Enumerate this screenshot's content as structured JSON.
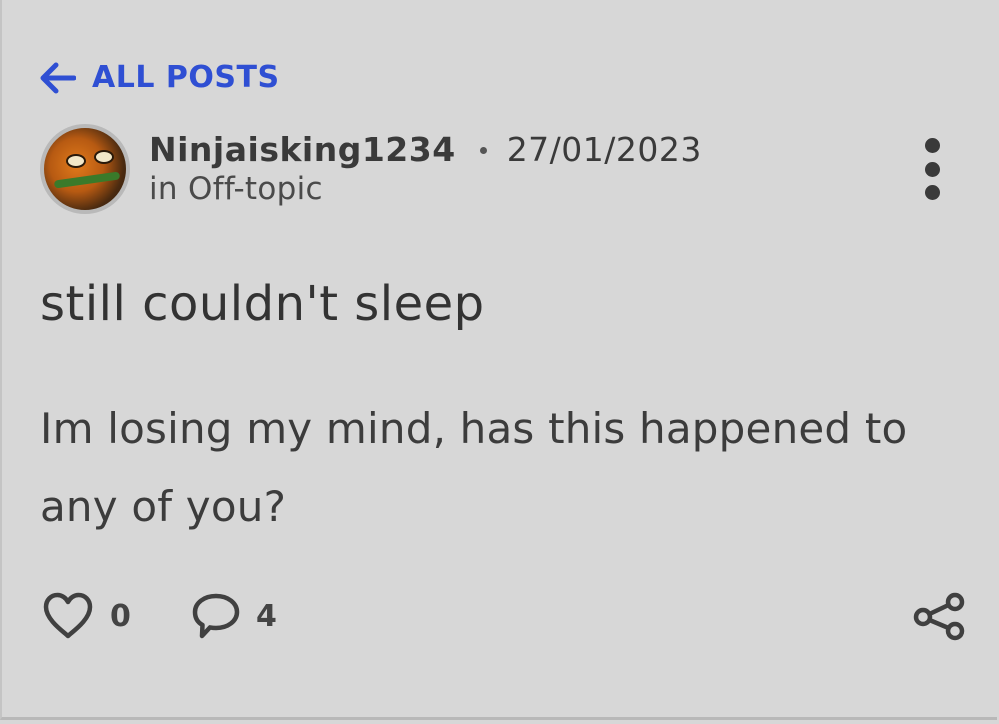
{
  "nav": {
    "back_label": "ALL POSTS",
    "accent_color": "#2f4fd3"
  },
  "post": {
    "author": "Ninjaisking1234",
    "date": "27/01/2023",
    "category": "in Off-topic",
    "title": "still couldn't sleep",
    "body": "Im losing my mind, has this happened to any of you?"
  },
  "stats": {
    "likes": "0",
    "comments": "4"
  },
  "icons": {
    "back": "arrow-left-icon",
    "more": "more-vertical-icon",
    "like": "heart-icon",
    "comment": "chat-bubble-icon",
    "share": "share-icon"
  }
}
